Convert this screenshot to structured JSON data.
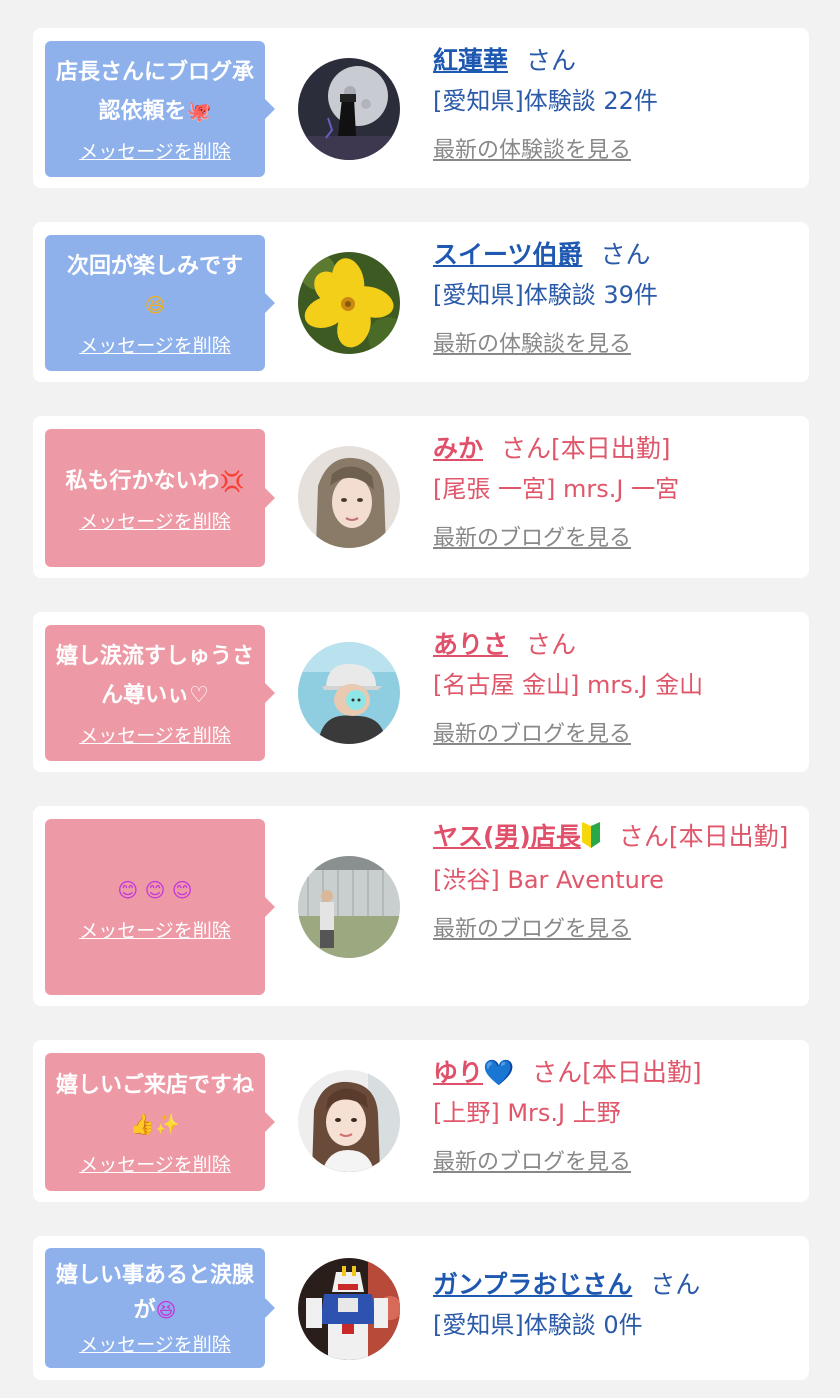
{
  "cards": [
    {
      "bubble_message": "店長さんにブログ承認依頼を",
      "bubble_emoji": "🐙",
      "delete_label": "メッセージを削除",
      "name": "紅蓮華",
      "san": "さん",
      "status": "",
      "area": "[愛知県]体験談 22件",
      "latest_label": "最新の体験談を見る",
      "theme": "blue"
    },
    {
      "bubble_message": "次回が楽しみです",
      "bubble_emoji": "😆",
      "delete_label": "メッセージを削除",
      "name": "スイーツ伯爵",
      "san": "さん",
      "status": "",
      "area": "[愛知県]体験談 39件",
      "latest_label": "最新の体験談を見る",
      "theme": "blue"
    },
    {
      "bubble_message": "私も行かないわ",
      "bubble_emoji": "💢",
      "delete_label": "メッセージを削除",
      "name": "みか",
      "san": "さん",
      "status": "[本日出勤]",
      "area": "[尾張 一宮] mrs.J 一宮",
      "latest_label": "最新のブログを見る",
      "theme": "pink"
    },
    {
      "bubble_message": "嬉し涙流すしゅうさん尊いぃ♡",
      "bubble_emoji": "",
      "delete_label": "メッセージを削除",
      "name": "ありさ",
      "san": "さん",
      "status": "",
      "area": "[名古屋 金山] mrs.J 金山",
      "latest_label": "最新のブログを見る",
      "theme": "pink"
    },
    {
      "bubble_message": "",
      "bubble_emoji": "😊 😊 😊",
      "delete_label": "メッセージを削除",
      "name": "ヤス(男)店長",
      "san": "さん",
      "status": "[本日出勤]",
      "area": "[渋谷] Bar Aventure",
      "latest_label": "最新のブログを見る",
      "theme": "pink"
    },
    {
      "bubble_message": "嬉しいご来店ですね",
      "bubble_emoji": "👍✨",
      "delete_label": "メッセージを削除",
      "name": "ゆり",
      "name_emoji": "💙",
      "san": "さん",
      "status": "[本日出勤]",
      "area": "[上野] Mrs.J 上野",
      "latest_label": "最新のブログを見る",
      "theme": "pink"
    },
    {
      "bubble_message": "嬉しい事あると涙腺が",
      "bubble_emoji": "😆",
      "delete_label": "メッセージを削除",
      "name": "ガンプラおじさん",
      "san": "さん",
      "status": "",
      "area": "[愛知県]体験談 0件",
      "latest_label": "",
      "theme": "blue"
    }
  ],
  "colors": {
    "page_bg": "#f2f2f2",
    "bubble_blue": "#8eb1ec",
    "bubble_pink": "#ee9aa6",
    "name_blue": "#1f58b0",
    "name_pink": "#e0506a",
    "link_gray": "#888888"
  }
}
